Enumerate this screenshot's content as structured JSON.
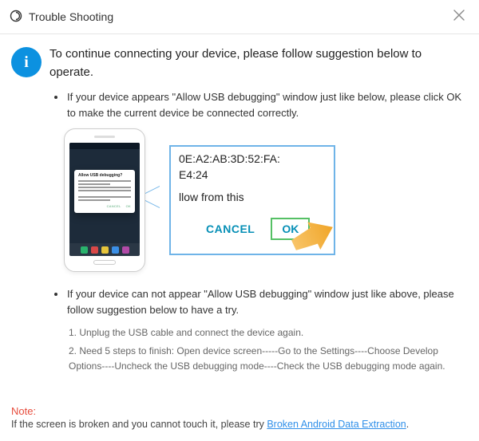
{
  "titlebar": {
    "title": "Trouble Shooting"
  },
  "heading": "To continue connecting your device, please follow suggestion below to operate.",
  "bullet1": "If your device appears \"Allow USB debugging\" window just like below, please click OK to make the current device  be connected correctly.",
  "phone": {
    "dialog_title": "Allow USB debugging?"
  },
  "zoom": {
    "id_line1": "0E:A2:AB:3D:52:FA:",
    "id_line2": "E4:24",
    "allow_text": "llow from this",
    "cancel": "CANCEL",
    "ok": "OK"
  },
  "bullet2": "If your device can not appear \"Allow USB debugging\" window just like above, please follow suggestion below to have a try.",
  "steps": {
    "s1": "1. Unplug the USB cable and connect the device again.",
    "s2": "2. Need 5 steps to finish: Open device screen-----Go to the Settings----Choose Develop Options----Uncheck the USB debugging mode----Check the USB debugging mode again."
  },
  "note": {
    "label": "Note:",
    "text": "If the screen is broken and you cannot touch it, please try ",
    "link": "Broken Android Data Extraction",
    "after": "."
  }
}
